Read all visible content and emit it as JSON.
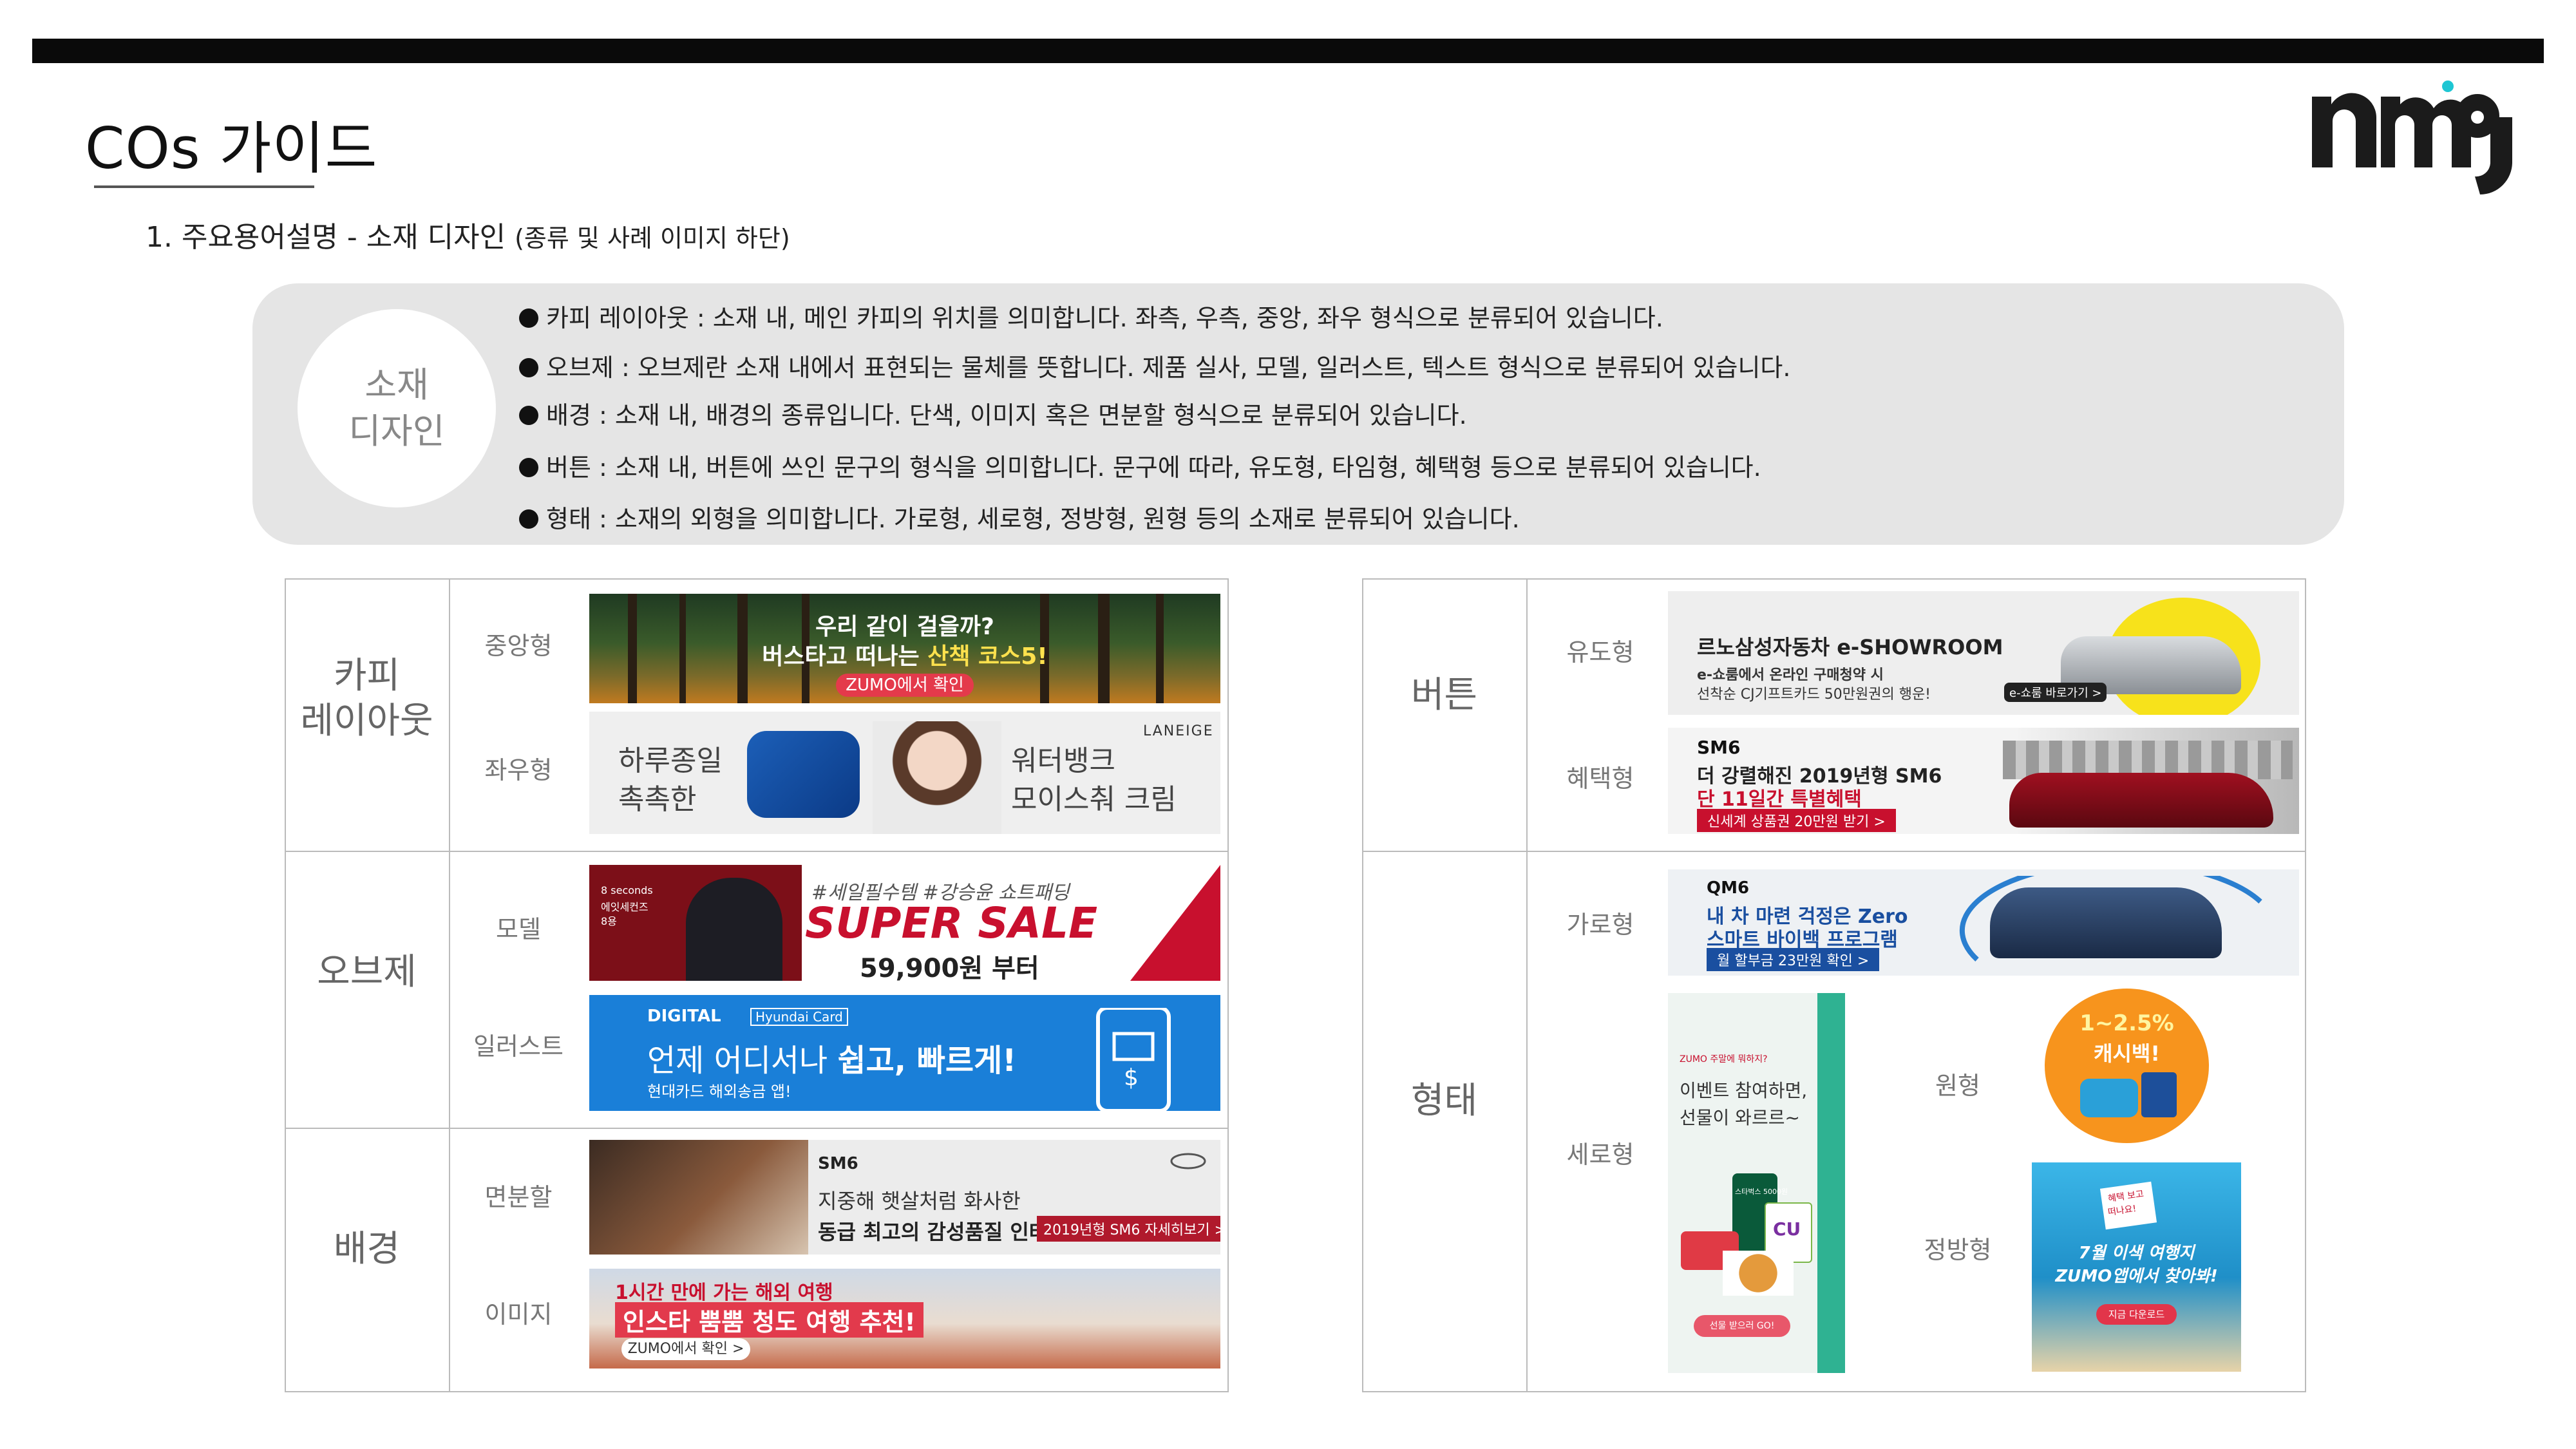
{
  "title": "COs 가이드",
  "logo_text": "nmg",
  "section": {
    "main": "1. 주요용어설명 - 소재 디자인 ",
    "sub": "(종류 및 사례 이미지 하단)"
  },
  "circle": {
    "line1": "소재",
    "line2": "디자인"
  },
  "bullets": [
    "카피 레이아웃 : 소재 내, 메인 카피의 위치를 의미합니다. 좌측, 우측, 중앙, 좌우 형식으로 분류되어 있습니다.",
    "오브제 : 오브제란 소재 내에서 표현되는 물체를 뜻합니다. 제품 실사, 모델, 일러스트, 텍스트 형식으로 분류되어 있습니다.",
    "배경 : 소재 내, 배경의 종류입니다. 단색, 이미지 혹은 면분할 형식으로 분류되어 있습니다.",
    "버튼 : 소재 내, 버튼에 쓰인 문구의 형식을 의미합니다. 문구에 따라, 유도형, 타임형, 혜택형 등으로 분류되어 있습니다.",
    "형태 : 소재의 외형을 의미합니다. 가로형, 세로형, 정방형, 원형 등의 소재로 분류되어 있습니다."
  ],
  "left_table": {
    "copy": {
      "cat1": "카피",
      "cat2": "레이아웃",
      "sub1": "중앙형",
      "sub2": "좌우형"
    },
    "object": {
      "cat": "오브제",
      "sub1": "모델",
      "sub2": "일러스트"
    },
    "background": {
      "cat": "배경",
      "sub1": "면분할",
      "sub2": "이미지"
    }
  },
  "right_table": {
    "button": {
      "cat": "버튼",
      "sub1": "유도형",
      "sub2": "혜택형"
    },
    "shape": {
      "cat": "형태",
      "sub1": "가로형",
      "sub2": "세로형",
      "sub3": "원형",
      "sub4": "정방형"
    }
  },
  "banners": {
    "forest": {
      "line1": "우리 같이 걸을까?",
      "line2a": "버스타고 떠나는 ",
      "line2b": "산책 코스5!",
      "pill": "ZUMO에서 확인"
    },
    "laneige": {
      "left1": "하루종일",
      "left2": "촉촉한",
      "brand": "LANEIGE",
      "right1": "워터뱅크",
      "right2": "모이스춰 크림"
    },
    "sale": {
      "side1": "8 seconds",
      "side2": "에잇세컨즈",
      "side3": "8용",
      "tag": "#세일필수템 #강승윤 쇼트패딩",
      "big": "SUPER SALE",
      "price": "59,900원 부터"
    },
    "digital": {
      "brand": "DIGITAL",
      "card": "Hyundai Card",
      "line1a": "언제 어디서나 ",
      "line1b": "쉽고, 빠르게!",
      "line2": "현대카드 해외송금 앱!"
    },
    "sm6a": {
      "brand": "SM6",
      "line1": "지중해 햇살처럼 화사한",
      "line2": "동급 최고의 감성품질 인테리어",
      "btn": "2019년형 SM6 자세히보기 >"
    },
    "travel": {
      "line1": "1시간 만에 가는 해외 여행",
      "line2": "인스타 뿜뿜 청도 여행 추천!",
      "pill": "ZUMO에서 확인 >"
    },
    "showroom": {
      "title": "르노삼성자동차 e-SHOWROOM",
      "line1": "e-쇼룸에서 온라인 구매청약 시",
      "line2": "선착순 CJ기프트카드 50만원권의 행운!",
      "btn": "e-쇼룸 바로가기 >"
    },
    "sm6b": {
      "brand": "SM6",
      "line1": "더 강렬해진 2019년형 SM6",
      "line2": "단 11일간 특별혜택",
      "btn": "신세계 상품권 20만원 받기 >"
    },
    "qm6": {
      "brand": "QM6",
      "line1": "내 차 마련 걱정은 Zero",
      "line2": "스마트 바이백 프로그램",
      "btn": "월 할부금 23만원 확인 >"
    },
    "vertical": {
      "top": "ZUMO 주말에 뭐하지?",
      "line1": "이벤트 참여하면,",
      "line2": "선물이 와르르~",
      "gift": "스타벅스 5000원",
      "cu": "CU",
      "btn": "선물 받으러 GO!"
    },
    "circle_ad": {
      "pct": "1~2.5%",
      "text": "캐시백!"
    },
    "square_ad": {
      "sticker1": "혜택 보고",
      "sticker2": "떠나요!",
      "line1": "7월 이색 여행지",
      "line2": "ZUMO앱에서 찾아봐!",
      "btn": "지금 다운로드"
    }
  },
  "colors": {
    "accent_red": "#c8102e",
    "panel_gray": "#e5e5e5",
    "blue": "#1a7fd8",
    "orange": "#f7941d"
  }
}
